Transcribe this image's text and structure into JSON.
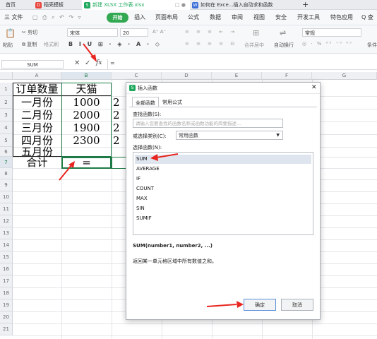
{
  "tabs": [
    {
      "label": "首页",
      "icon": "home-icon",
      "color": "#2b6fd6"
    },
    {
      "label": "稻壳模板",
      "icon": "daoke-icon",
      "color": "#e8453c"
    },
    {
      "label": "新建 XLSX 工作表.xlsx",
      "icon": "sheet-icon",
      "color": "#1ea85c"
    },
    {
      "label": "如何在 Exce...插入自动求和函数",
      "icon": "doc-icon",
      "color": "#3b6fd8"
    },
    {
      "add_label": "+"
    }
  ],
  "menu": {
    "file": "三 文件",
    "start": "开始",
    "items": [
      "插入",
      "页面布局",
      "公式",
      "数据",
      "审阅",
      "视图",
      "安全",
      "开发工具",
      "特色应用"
    ],
    "search": "Q 查"
  },
  "ribbon": {
    "paste": "粘贴",
    "cut": "剪切",
    "copy": "复制",
    "format_painter": "格式刷",
    "font_name": "宋体",
    "font_size": "20",
    "merge_center": "合并居中",
    "auto_wrap": "自动换行",
    "number_format": "常规",
    "cond": "条件"
  },
  "formula_bar": {
    "name_box": "SUM",
    "cancel": "✕",
    "enter": "✓",
    "fx": "fx",
    "content": "="
  },
  "columns": [
    "A",
    "B",
    "C",
    "D",
    "E",
    "F",
    "G"
  ],
  "rows": [
    "1",
    "2",
    "3",
    "4",
    "5",
    "6",
    "7",
    "8",
    "9",
    "10",
    "11",
    "12",
    "13",
    "14",
    "15",
    "16",
    "17",
    "18",
    "19",
    "20",
    "21"
  ],
  "cells": {
    "a1": "订单数量",
    "b1": "天猫",
    "a2": "一月份",
    "b2": "1000",
    "a3": "二月份",
    "b3": "2000",
    "a4": "三月份",
    "b4": "1900",
    "a5": "四月份",
    "b5": "2300",
    "a6": "五月份",
    "a7": "合计",
    "b7": "=",
    "c_partial": [
      "2",
      "2",
      "2",
      "2"
    ]
  },
  "dialog": {
    "title": "插入函数",
    "tab_all": "全部函数",
    "tab_common": "常用公式",
    "search_label": "查找函数(S):",
    "search_placeholder": "请输入您要查找的函数名称或函数功能的简要描述...",
    "category_label": "或选择类别(C):",
    "category_value": "常用函数",
    "select_label": "选择函数(N):",
    "functions": [
      "SUM",
      "AVERAGE",
      "IF",
      "COUNT",
      "MAX",
      "SIN",
      "SUMIF"
    ],
    "signature": "SUM(number1, number2, ...)",
    "description": "返回某一单元格区域中所有数值之和。",
    "ok": "确定",
    "cancel": "取消",
    "close": "✕"
  },
  "colors": {
    "accent_green": "#33a852",
    "arrow_red": "#e8251f",
    "selected_fn": "#dfe5ee"
  }
}
